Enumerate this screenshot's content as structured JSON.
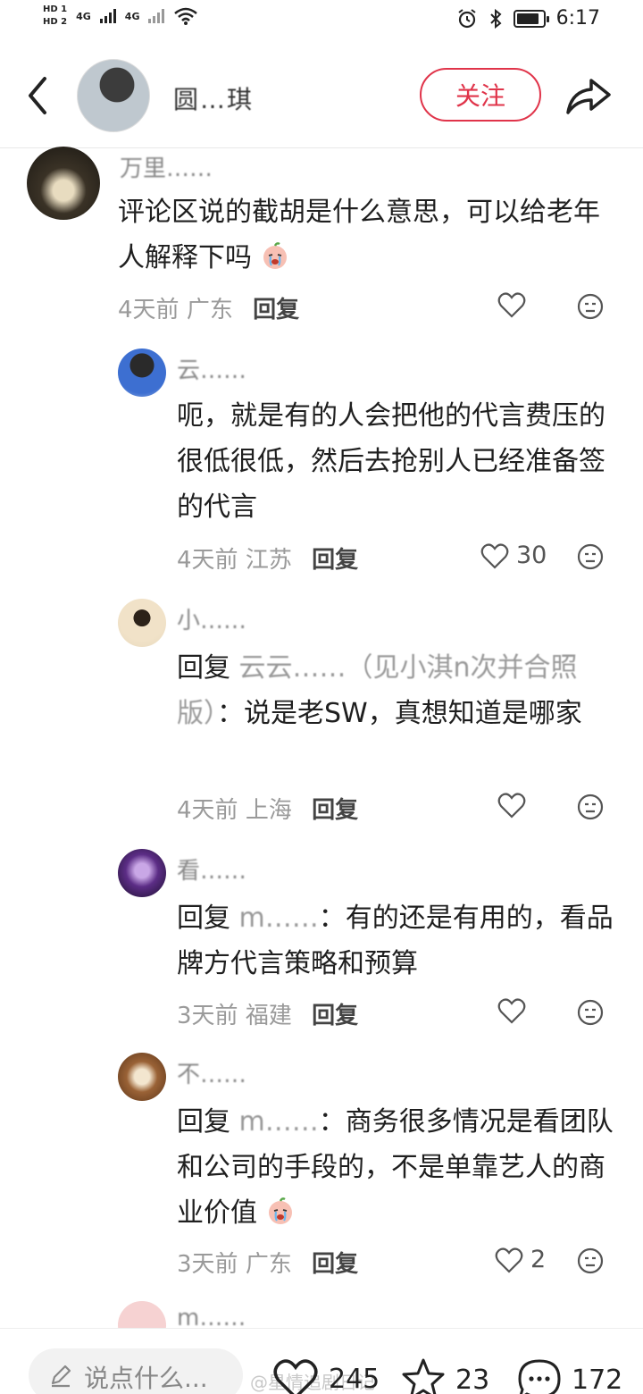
{
  "status_bar": {
    "hd1": "HD 1",
    "hd2": "HD 2",
    "net1": "4G",
    "net2": "4G",
    "time": "6:17"
  },
  "header": {
    "title": "圆…琪",
    "follow_label": "关注"
  },
  "comments": [
    {
      "username": "万里……",
      "text": "评论区说的截胡是什么意思，可以给老年人解释下吗",
      "time": "4天前",
      "location": "广东",
      "reply_label": "回复",
      "likes": ""
    },
    {
      "username": "云……",
      "text": "呃，就是有的人会把他的代言费压的很低很低，然后去抢别人已经准备签的代言",
      "time": "4天前",
      "location": "江苏",
      "reply_label": "回复",
      "likes": "30"
    },
    {
      "username": "小……",
      "reply_prefix": "回复",
      "reply_target": "云云……（见小淇n次并合照版）",
      "text": "：说是老SW，真想知道是哪家",
      "time": "4天前",
      "location": "上海",
      "reply_label": "回复",
      "likes": ""
    },
    {
      "username": "看……",
      "reply_prefix": "回复",
      "reply_target": "m……",
      "text": "：有的还是有用的，看品牌方代言策略和预算",
      "time": "3天前",
      "location": "福建",
      "reply_label": "回复",
      "likes": ""
    },
    {
      "username": "不……",
      "reply_prefix": "回复",
      "reply_target": "m……",
      "text": "：商务很多情况是看团队和公司的手段的，不是单靠艺人的商业价值",
      "time": "3天前",
      "location": "广东",
      "reply_label": "回复",
      "likes": "2"
    },
    {
      "username": "m……"
    }
  ],
  "bottom_bar": {
    "input_placeholder": "说点什么...",
    "likes": "245",
    "stars": "23",
    "comments": "172",
    "watermark": "@星情追剧日记"
  },
  "colors": {
    "accent": "#e0344a",
    "meta_gray": "#9a9a9a"
  }
}
